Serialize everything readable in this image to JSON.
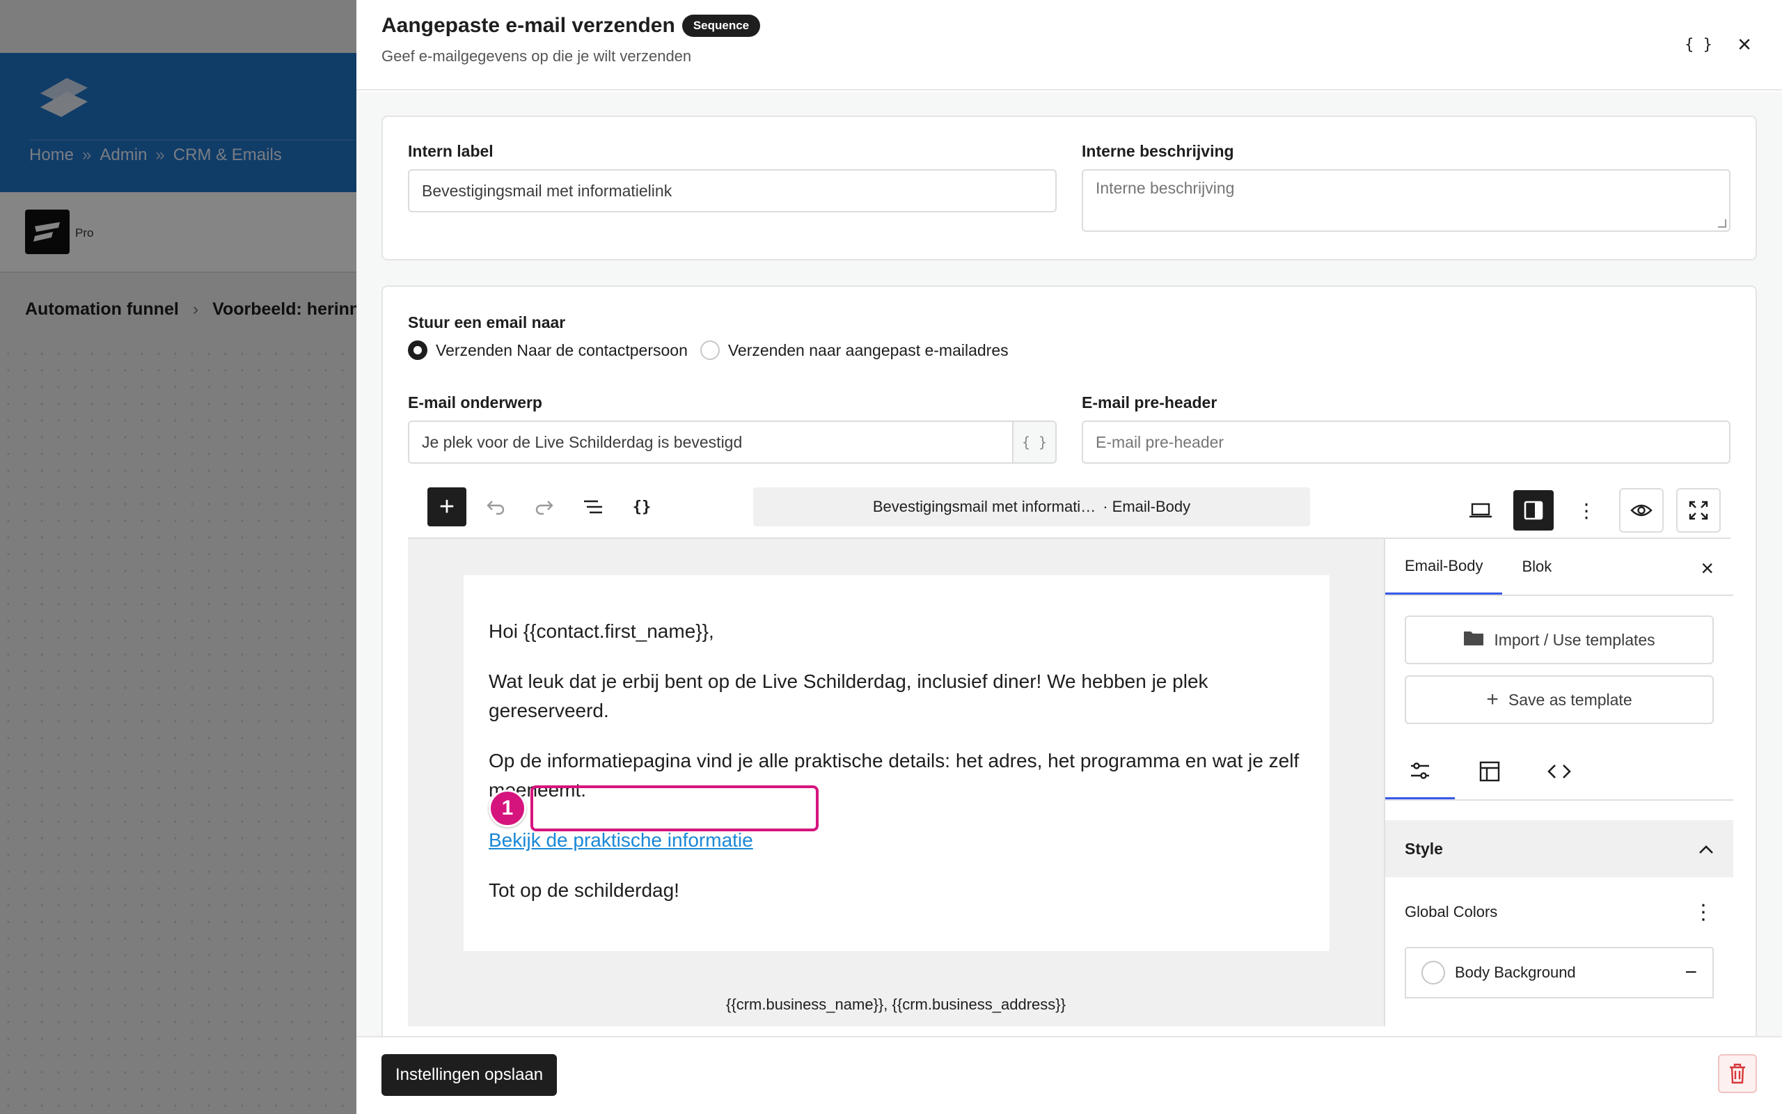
{
  "background_app": {
    "breadcrumb": [
      "Home",
      "Admin",
      "CRM & Emails"
    ],
    "breadcrumb_sep": "»",
    "brand_tag": "Pro",
    "funnel": [
      "Automation funnel",
      "Voorbeeld: herinner"
    ]
  },
  "drawer": {
    "title": "Aangepaste e-mail verzenden",
    "badge": "Sequence",
    "subtitle": "Geef e-mailgegevens op die je wilt verzenden",
    "code_btn": "{ }",
    "close_btn": "×"
  },
  "form": {
    "intern_label": {
      "label": "Intern label",
      "value": "Bevestigingsmail met informatielink"
    },
    "interne_beschrijving": {
      "label": "Interne beschrijving",
      "placeholder": "Interne beschrijving"
    },
    "send_to": {
      "label": "Stuur een email naar",
      "options": [
        "Verzenden Naar de contactpersoon",
        "Verzenden naar aangepast e-mailadres"
      ],
      "selected": 0
    },
    "subject": {
      "label": "E-mail onderwerp",
      "value": "Je plek voor de Live Schilderdag is bevestigd",
      "merge": "{ }"
    },
    "preheader": {
      "label": "E-mail pre-header",
      "placeholder": "E-mail pre-header"
    }
  },
  "editor": {
    "doc_title": "Bevestigingsmail met informati…",
    "doc_sub": "· Email-Body",
    "email": {
      "greeting": "Hoi {{contact.first_name}},",
      "p1": "Wat leuk dat je erbij bent op de Live Schilderdag, inclusief diner! We hebben je plek gereserveerd.",
      "p2": "Op de informatiepagina vind je alle praktische details: het adres, het programma en wat je zelf meeneemt.",
      "link": "Bekijk de praktische informatie",
      "closing": "Tot op de schilderdag!",
      "footer": "{{crm.business_name}}, {{crm.business_address}}"
    },
    "marker": "1",
    "highlight_color": "#d6147e"
  },
  "sidebar": {
    "tabs": [
      "Email-Body",
      "Blok"
    ],
    "import_btn": "Import / Use templates",
    "save_template_btn": "Save as template",
    "style_heading": "Style",
    "global_colors": "Global Colors",
    "body_background": "Body Background"
  },
  "footer": {
    "save": "Instellingen opslaan"
  }
}
